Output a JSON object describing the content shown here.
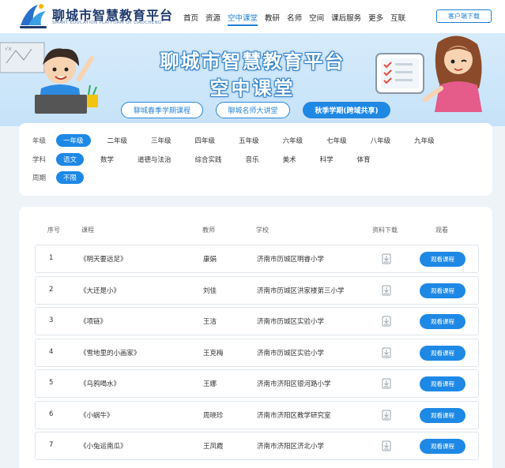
{
  "header": {
    "brand_title": "聊城市智慧教育平台",
    "brand_subtitle": "SMART EDUCATION PLATFORM OF LIAOCHENG",
    "nav": [
      "首页",
      "资源",
      "空中课堂",
      "教研",
      "名师",
      "空间",
      "课后服务",
      "更多",
      "互联"
    ],
    "nav_active_index": 2,
    "download_label": "客户端下载"
  },
  "banner": {
    "title_line1": "聊城市智慧教育平台",
    "title_line2": "空中课堂",
    "tabs": [
      "聊城春季学期课程",
      "聊城名师大讲堂",
      "秋季学期(跨域共享)"
    ],
    "active_tab_index": 2
  },
  "filters": {
    "grade": {
      "label": "年级",
      "options": [
        "一年级",
        "二年级",
        "三年级",
        "四年级",
        "五年级",
        "六年级",
        "七年级",
        "八年级",
        "九年级"
      ],
      "selected": 0
    },
    "subject": {
      "label": "学科",
      "options": [
        "语文",
        "数学",
        "道德与法治",
        "综合实践",
        "音乐",
        "美术",
        "科学",
        "体育"
      ],
      "selected": 0
    },
    "week": {
      "label": "周期",
      "options": [
        "不限"
      ],
      "selected": 0
    }
  },
  "table": {
    "headers": {
      "no": "序号",
      "course": "课程",
      "teacher": "教师",
      "school": "学校",
      "download": "资料下载",
      "watch": "观看"
    },
    "watch_label": "观看课程",
    "rows": [
      {
        "no": "1",
        "course": "《明天要远足》",
        "teacher": "康娟",
        "school": "济南市历城区明睿小学"
      },
      {
        "no": "2",
        "course": "《大还是小》",
        "teacher": "刘佳",
        "school": "济南市历城区洪家楼第三小学"
      },
      {
        "no": "3",
        "course": "《项链》",
        "teacher": "王洁",
        "school": "济南市历城区实验小学"
      },
      {
        "no": "4",
        "course": "《雪地里的小画家》",
        "teacher": "王克梅",
        "school": "济南市历城区实验小学"
      },
      {
        "no": "5",
        "course": "《乌鸦喝水》",
        "teacher": "王娜",
        "school": "济南市济阳区银河路小学"
      },
      {
        "no": "6",
        "course": "《小蜗牛》",
        "teacher": "周晓珍",
        "school": "济南市济阳区教学研究室"
      },
      {
        "no": "7",
        "course": "《小兔运南瓜》",
        "teacher": "王凤霞",
        "school": "济南市济阳区济北小学"
      }
    ]
  },
  "colors": {
    "accent": "#1e88e5",
    "brand": "#1f3a6e"
  }
}
